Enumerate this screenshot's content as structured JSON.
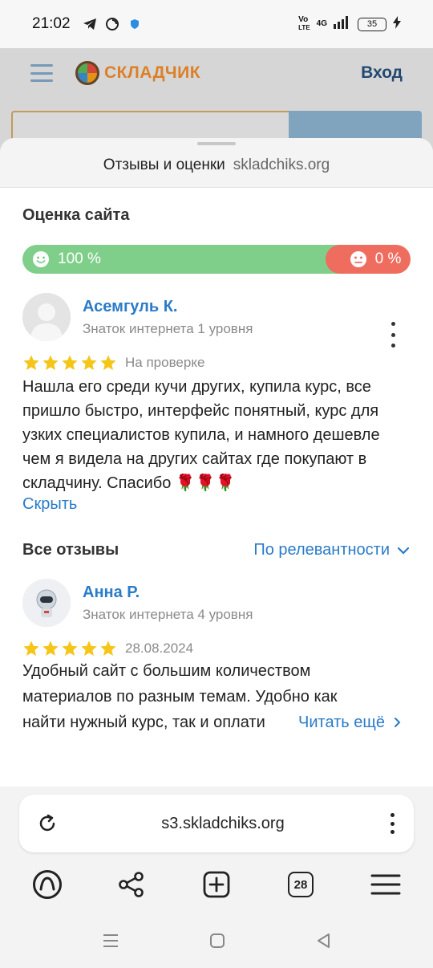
{
  "status_bar": {
    "time": "21:02",
    "network_top": "Vo",
    "network_bottom": "LTE",
    "signal_label": "4G",
    "battery": "35"
  },
  "background": {
    "logo_text": "СКЛАДЧИК",
    "login": "Вход"
  },
  "sheet": {
    "title": "Отзывы и оценки",
    "domain": "skladchiks.org",
    "site_rating_title": "Оценка сайта",
    "positive_percent": "100 %",
    "negative_percent": "0 %",
    "positive_fraction": 1.0
  },
  "featured_review": {
    "author": "Асемгуль К.",
    "level": "Знаток интернета 1 уровня",
    "stars": 5,
    "status": "На проверке",
    "text": "Нашла его среди кучи других, купила курс, все пришло быстро, интерфейс понятный, курс для узких специалистов купила, и намного дешевле чем я видела на других сайтах где покупают в складчину. Спасибо 🌹🌹🌹",
    "hide_link": "Скрыть"
  },
  "all_reviews": {
    "title": "Все отзывы",
    "sort_label": "По релевантности"
  },
  "second_review": {
    "author": "Анна Р.",
    "level": "Знаток интернета 4 уровня",
    "stars": 5,
    "date": "28.08.2024",
    "text_line1": "Удобный сайт с большим количеством",
    "text_line2": "материалов по разным темам. Удобно как",
    "text_line3": "найти нужный курс, так и оплати",
    "read_more": "Читать ещё"
  },
  "browser": {
    "url": "s3.skladchiks.org",
    "tabs_count": "28"
  },
  "colors": {
    "accent": "#2a7bc8",
    "positive": "#7fcf8a",
    "negative": "#ef6d5f",
    "star": "#f5c518"
  }
}
